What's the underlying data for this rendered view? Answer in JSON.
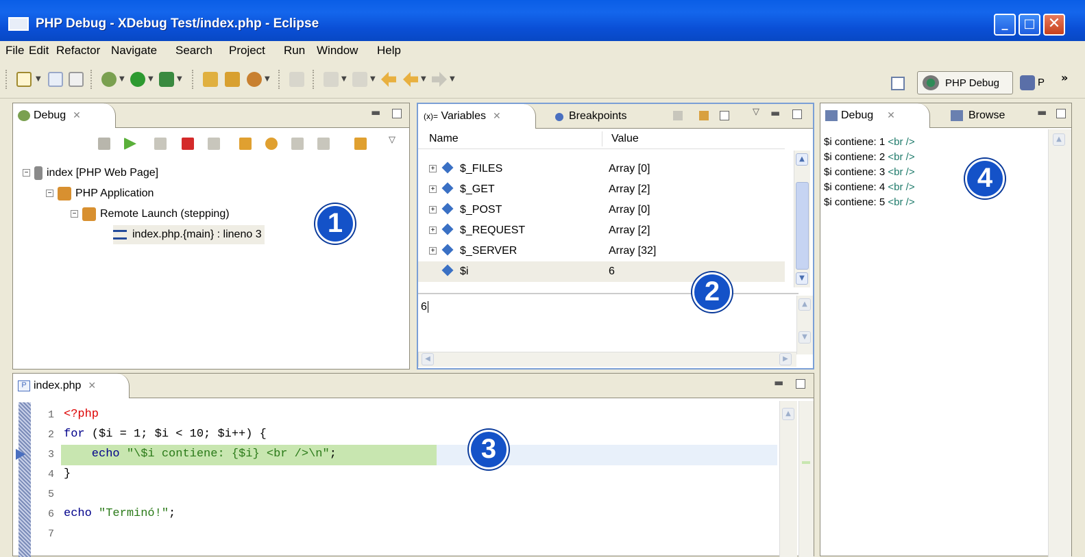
{
  "window": {
    "title": "PHP Debug - XDebug Test/index.php - Eclipse",
    "min": "_",
    "max": "□",
    "close": "✕"
  },
  "menu": [
    "File",
    "Edit",
    "Refactor",
    "Navigate",
    "Search",
    "Project",
    "Run",
    "Window",
    "Help"
  ],
  "perspective": {
    "active": "PHP Debug",
    "other": "P",
    "more": "»"
  },
  "debug_view": {
    "tab": "Debug",
    "tree": [
      {
        "label": "index [PHP Web Page]"
      },
      {
        "label": "PHP Application"
      },
      {
        "label": "Remote Launch (stepping)"
      },
      {
        "label": "index.php.{main} : lineno 3"
      }
    ]
  },
  "variables_view": {
    "tabs": [
      "Variables",
      "Breakpoints"
    ],
    "columns": [
      "Name",
      "Value"
    ],
    "rows": [
      {
        "name": "$_FILES",
        "value": "Array [0]"
      },
      {
        "name": "$_GET",
        "value": "Array [2]"
      },
      {
        "name": "$_POST",
        "value": "Array [0]"
      },
      {
        "name": "$_REQUEST",
        "value": "Array [2]"
      },
      {
        "name": "$_SERVER",
        "value": "Array [32]"
      },
      {
        "name": "$i",
        "value": "6"
      }
    ],
    "detail": "6"
  },
  "right_view": {
    "tabs": [
      "Debug",
      "Browse"
    ],
    "output": [
      {
        "text": "$i contiene: 1 ",
        "tag": "<br />"
      },
      {
        "text": "$i contiene: 2 ",
        "tag": "<br />"
      },
      {
        "text": "$i contiene: 3 ",
        "tag": "<br />"
      },
      {
        "text": "$i contiene: 4 ",
        "tag": "<br />"
      },
      {
        "text": "$i contiene: 5 ",
        "tag": "<br />"
      }
    ]
  },
  "editor": {
    "tab": "index.php",
    "lines": [
      "1",
      "2",
      "3",
      "4",
      "5",
      "6",
      "7"
    ],
    "code": {
      "l1": "<?php",
      "l2_kw": "for",
      "l2_rest": " ($i = 1; $i < 10; $i++) {",
      "l3_kw": "    echo ",
      "l3_str": "\"\\$i contiene: {$i} <br />\\n\"",
      "l3_end": ";",
      "l4": "}",
      "l6_kw": "echo ",
      "l6_str": "\"Terminó!\"",
      "l6_end": ";"
    }
  },
  "callouts": [
    "1",
    "2",
    "3",
    "4"
  ],
  "colors": {
    "titlebar": "#0a5ee6",
    "chrome": "#ece9d8",
    "exec_line": "#c8e6b0",
    "callout": "#1452c8"
  }
}
